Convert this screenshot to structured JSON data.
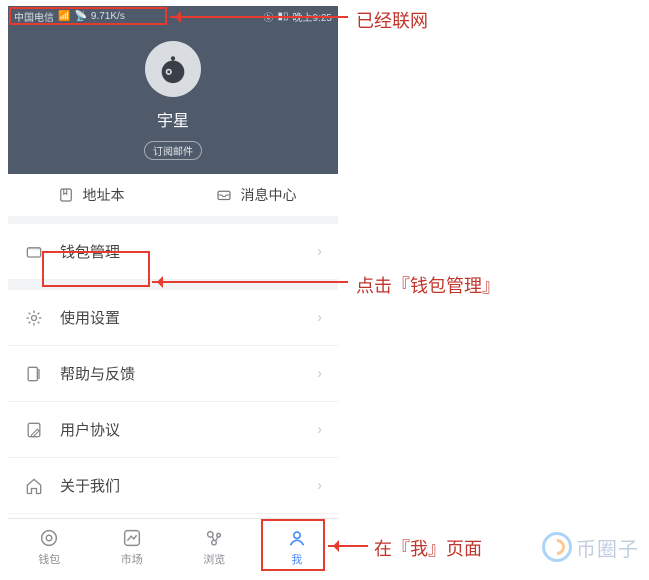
{
  "status": {
    "carrier": "中国电信",
    "speed": "9.71K/s",
    "right": "晚上9:25"
  },
  "profile": {
    "name": "宇星",
    "subscribe": "订阅邮件"
  },
  "quick": {
    "address_book": "地址本",
    "message_center": "消息中心"
  },
  "menu": {
    "wallet_mgmt": "钱包管理",
    "settings": "使用设置",
    "help": "帮助与反馈",
    "agreement": "用户协议",
    "about": "关于我们"
  },
  "tabs": {
    "wallet": "钱包",
    "market": "市场",
    "browse": "浏览",
    "me": "我"
  },
  "annotations": {
    "networked": "已经联网",
    "click_wallet": "点击『钱包管理』",
    "on_me_page": "在『我』页面"
  },
  "watermark": "币圈子"
}
